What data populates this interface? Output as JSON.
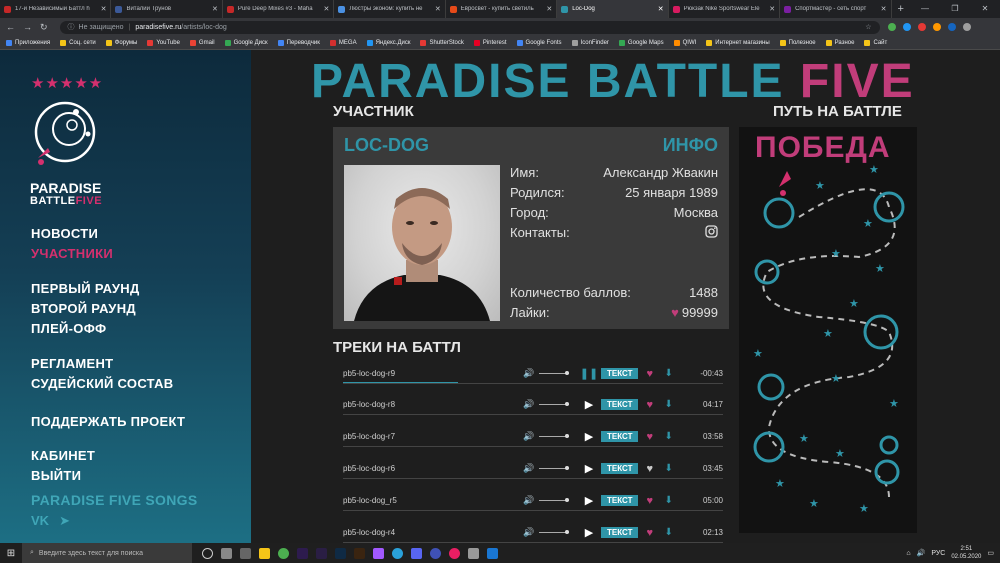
{
  "browser": {
    "tabs": [
      {
        "title": "17-й Независимый Баттл h",
        "color": "#c62828"
      },
      {
        "title": "Виталий Трунов",
        "color": "#3b5998"
      },
      {
        "title": "Pure Deep Mixes #3 - Maha",
        "color": "#c62828"
      },
      {
        "title": "Люстры эконом: купить не",
        "color": "#4a90e2"
      },
      {
        "title": "Евросвет - купить светиль",
        "color": "#e64a19"
      },
      {
        "title": "Loc-Dog",
        "color": "#2f95a8"
      },
      {
        "title": "Рюкзак Nike Sportswear Ele",
        "color": "#d81b60"
      },
      {
        "title": "Спортмастер - сеть спорт",
        "color": "#7b1fa2"
      }
    ],
    "security": "Не защищено",
    "url_domain": "paradisefive.ru",
    "url_path": "/artists/loc-dog",
    "bookmarks": [
      "Приложения",
      "Соц. сети",
      "Форумы",
      "YouTube",
      "Gmail",
      "Google Диск",
      "Переводчик",
      "MEGA",
      "Яндекс.Диск",
      "ShutterStock",
      "Pinterest",
      "Google Fonts",
      "IconFinder",
      "Google Maps",
      "QIWI",
      "Интернет магазины",
      "Полезное",
      "Разное",
      "Сайт"
    ]
  },
  "sidebar": {
    "stars": "★★★★★",
    "logo_line1": "PARADISE",
    "logo_line2a": "BATTLE",
    "logo_line2b": "FIVE",
    "menu": {
      "news": "НОВОСТИ",
      "participants": "УЧАСТНИКИ",
      "round1": "ПЕРВЫЙ РАУНД",
      "round2": "ВТОРОЙ РАУНД",
      "playoff": "ПЛЕЙ-ОФФ",
      "rules": "РЕГЛАМЕНТ",
      "judges": "СУДЕЙСКИЙ СОСТАВ",
      "support": "ПОДДЕРЖАТЬ ПРОЕКТ",
      "cabinet": "КАБИНЕТ",
      "logout": "ВЫЙТИ",
      "songs": "PARADISE FIVE SONGS"
    },
    "social": {
      "vk": "VK",
      "tg": "➤"
    }
  },
  "main": {
    "title_a": "PARADISE BATTLE",
    "title_b": "FIVE",
    "participant_heading": "УЧАСТНИК",
    "path_heading": "ПУТЬ НА БАТТЛЕ",
    "card": {
      "name": "LOC-DOG",
      "info": "ИНФО",
      "fields": {
        "name_label": "Имя:",
        "name_value": "Александр Жвакин",
        "born_label": "Родился:",
        "born_value": "25 января 1989",
        "city_label": "Город:",
        "city_value": "Москва",
        "contacts_label": "Контакты:",
        "points_label": "Количество баллов:",
        "points_value": "1488",
        "likes_label": "Лайки:",
        "likes_value": "99999"
      }
    },
    "tracks_heading": "ТРЕКИ НА БАТТЛ",
    "text_button": "ТЕКСТ",
    "tracks": [
      {
        "name": "pb5-loc-dog-r9",
        "time": "-00:43",
        "playing": true,
        "liked": true
      },
      {
        "name": "pb5-loc-dog-r8",
        "time": "04:17",
        "playing": false,
        "liked": true
      },
      {
        "name": "pb5-loc-dog-r7",
        "time": "03:58",
        "playing": false,
        "liked": true
      },
      {
        "name": "pb5-loc-dog-r6",
        "time": "03:45",
        "playing": false,
        "liked": false
      },
      {
        "name": "pb5-loc-dog_r5",
        "time": "05:00",
        "playing": false,
        "liked": true
      },
      {
        "name": "pb5-loc-dog-r4",
        "time": "02:13",
        "playing": false,
        "liked": true
      }
    ],
    "victory": "ПОБЕДА"
  },
  "taskbar": {
    "search_placeholder": "Введите здесь текст для поиска",
    "lang": "РУС",
    "time": "2:51",
    "date": "02.05.2020"
  }
}
